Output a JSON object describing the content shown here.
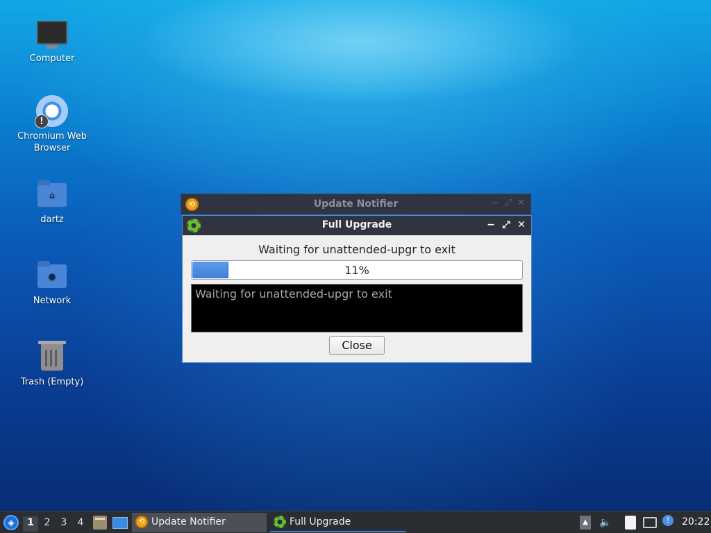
{
  "desktop": {
    "icons": [
      {
        "label": "Computer",
        "icon": "computer-icon"
      },
      {
        "label": "Chromium Web Browser",
        "icon": "chromium-icon"
      },
      {
        "label": "dartz",
        "icon": "home-folder-icon"
      },
      {
        "label": "Network",
        "icon": "network-folder-icon"
      },
      {
        "label": "Trash (Empty)",
        "icon": "trash-icon"
      }
    ]
  },
  "back_window": {
    "title": "Update Notifier",
    "icon": "update-notifier-icon"
  },
  "dialog": {
    "title": "Full Upgrade",
    "icon": "gear-icon",
    "status": "Waiting for unattended-upgr to exit",
    "progress_percent": 11,
    "progress_label": "11%",
    "log": "Waiting for unattended-upgr to exit",
    "close_label": "Close"
  },
  "taskbar": {
    "workspaces": [
      "1",
      "2",
      "3",
      "4"
    ],
    "active_workspace": "1",
    "tasks": [
      {
        "label": "Update Notifier",
        "icon": "update-notifier-icon"
      },
      {
        "label": "Full Upgrade",
        "icon": "gear-icon"
      }
    ],
    "clock": "20:22"
  },
  "colors": {
    "titlebar": "#2f3440",
    "progress": "#3e7fda",
    "taskbar": "#2a2d32"
  }
}
